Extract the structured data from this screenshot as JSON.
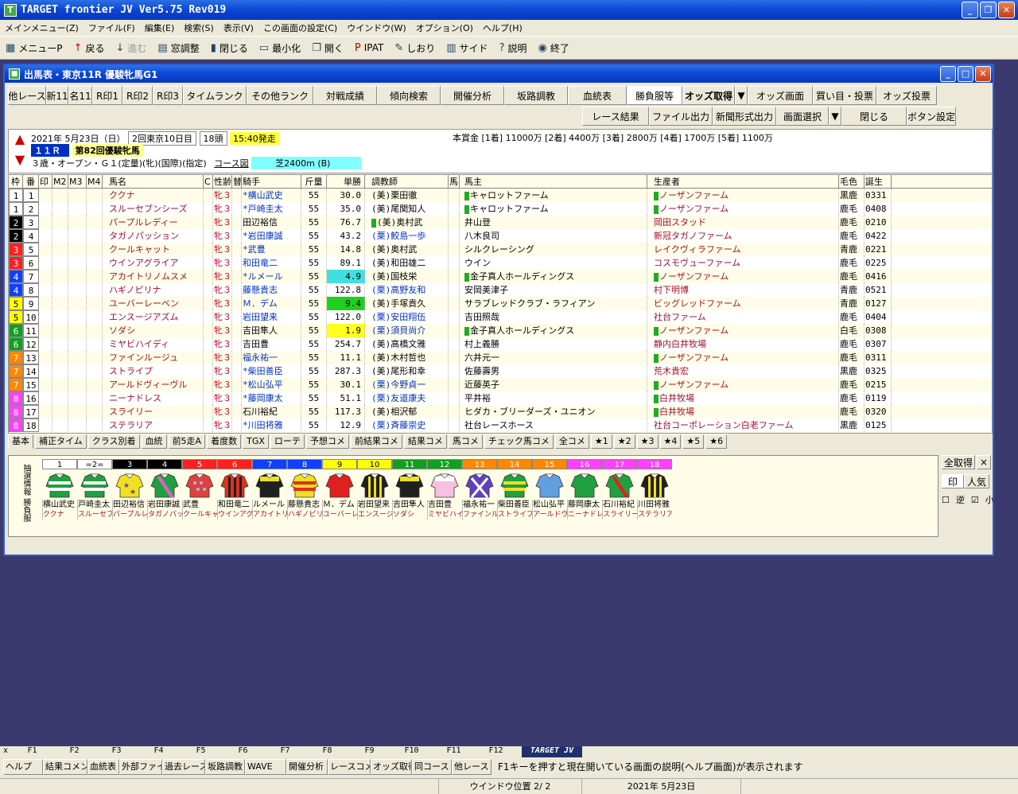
{
  "app": {
    "title": "TARGET frontier JV  Ver5.75  Rev019"
  },
  "menu": [
    "メインメニュー(Z)",
    "ファイル(F)",
    "編集(E)",
    "検索(S)",
    "表示(V)",
    "この画面の設定(C)",
    "ウインドウ(W)",
    "オプション(O)",
    "ヘルプ(H)"
  ],
  "toolbar": [
    {
      "label": "メニューP",
      "icon": "menu-icon"
    },
    {
      "label": "戻る",
      "icon": "up-arrow-icon"
    },
    {
      "label": "進む",
      "icon": "down-arrow-icon",
      "disabled": true
    },
    {
      "label": "窓調整",
      "icon": "window-icon"
    },
    {
      "label": "閉じる",
      "icon": "door-icon"
    },
    {
      "label": "最小化",
      "icon": "minimize-icon"
    },
    {
      "label": "開く",
      "icon": "open-icon"
    },
    {
      "label": "IPAT",
      "icon": "pat-icon"
    },
    {
      "label": "しおり",
      "icon": "bookmark-icon"
    },
    {
      "label": "サイド",
      "icon": "side-icon"
    },
    {
      "label": "説明",
      "icon": "help-icon"
    },
    {
      "label": "終了",
      "icon": "exit-icon"
    }
  ],
  "window": {
    "title": "出馬表・東京11R 優駿牝馬G1"
  },
  "buttons_row1": [
    {
      "label": "他レース",
      "w": 48
    },
    {
      "label": "新11",
      "w": 28
    },
    {
      "label": "名11",
      "w": 30
    },
    {
      "label": "R印1",
      "w": 38
    },
    {
      "label": "R印2",
      "w": 38
    },
    {
      "label": "R印3",
      "w": 38
    },
    {
      "label": "タイムランク",
      "w": 80
    },
    {
      "label": "その他ランク",
      "w": 84
    },
    {
      "label": "対戦成績",
      "w": 80
    },
    {
      "label": "傾向検索",
      "w": 80
    },
    {
      "label": "開催分析",
      "w": 80
    },
    {
      "label": "坂路調教",
      "w": 80
    },
    {
      "label": "血統表",
      "w": 74
    },
    {
      "label": "勝負服等",
      "w": 70,
      "sel": true
    },
    {
      "label": "オッズ取得",
      "w": 66,
      "bold": true
    },
    {
      "label": "▼",
      "w": 16
    },
    {
      "label": "オッズ画面",
      "w": 82
    },
    {
      "label": "買い目・投票",
      "w": 80
    },
    {
      "label": "オッズ投票",
      "w": 76
    }
  ],
  "buttons_row2": [
    {
      "label": "レース結果"
    },
    {
      "label": "ファイル出力"
    },
    {
      "label": "新聞形式出力"
    },
    {
      "label": "画面選択"
    },
    {
      "label": "▼"
    },
    {
      "label": "閉じる"
    },
    {
      "label": "ボタン設定"
    }
  ],
  "race": {
    "date": "2021年 5月23日（日）",
    "kai": "2回東京10日目",
    "heads": "18頭",
    "start": "15:40発走",
    "rnum": "１１Ｒ",
    "name": "第82回優駿牝馬",
    "cond": "３歳・オープン・Ｇ１(定量)(牝)(国際)(指定)",
    "course_label": "コース図",
    "course": "芝2400m (B)",
    "prize": "本賞金 [1着] 11000万 [2着] 4400万 [3着] 2800万 [4着] 1700万 [5着] 1100万"
  },
  "columns": [
    "枠",
    "番",
    "印",
    "M2",
    "M3",
    "M4",
    "馬名",
    "C",
    "性齢",
    "替",
    "騎手",
    "斤量",
    "単勝",
    "調教師",
    "馬",
    "馬主",
    "生産者",
    "毛色",
    "誕生"
  ],
  "waku_colors": {
    "1": [
      "#ffffff",
      "#000"
    ],
    "2": [
      "#000000",
      "#fff"
    ],
    "3": [
      "#ff2020",
      "#fff"
    ],
    "4": [
      "#1040ff",
      "#fff"
    ],
    "5": [
      "#ffff00",
      "#000"
    ],
    "6": [
      "#10a020",
      "#fff"
    ],
    "7": [
      "#ff8800",
      "#fff"
    ],
    "8": [
      "#ff40ff",
      "#fff"
    ]
  },
  "horses": [
    {
      "waku": "1",
      "num": "1",
      "name": "ククナ",
      "sex": "牝３",
      "jockey": "*横山武史",
      "kg": "55",
      "odds": "30.0",
      "trainer": "(美)栗田徹",
      "m": "",
      "owner": "キャロットファーム",
      "oc": true,
      "breeder": "ノーザンファーム",
      "bc": true,
      "color": "黒鹿",
      "birth": "0331"
    },
    {
      "waku": "1",
      "num": "2",
      "name": "スルーセブンシーズ",
      "sex": "牝３",
      "jockey": "*戸崎圭太",
      "kg": "55",
      "odds": "35.0",
      "trainer": "(美)尾関知人",
      "m": "",
      "owner": "キャロットファーム",
      "oc": true,
      "breeder": "ノーザンファーム",
      "bc": true,
      "color": "鹿毛",
      "birth": "0408"
    },
    {
      "waku": "2",
      "num": "3",
      "name": "パープルレディー",
      "sex": "牝３",
      "jockey": "田辺裕信",
      "kg": "55",
      "odds": "76.7",
      "trainer": "(美)奥村武",
      "m": "",
      "owner": "井山登",
      "breeder": "岡田スタッド",
      "tc": true,
      "color": "鹿毛",
      "birth": "0210"
    },
    {
      "waku": "2",
      "num": "4",
      "name": "タガノパッション",
      "sex": "牝３",
      "jockey": "*岩田康誠",
      "kg": "55",
      "odds": "43.2",
      "trainer": "(栗)鮫島一歩",
      "m": "",
      "owner": "八木良司",
      "breeder": "新冠タガノファーム",
      "color": "鹿毛",
      "birth": "0422"
    },
    {
      "waku": "3",
      "num": "5",
      "name": "クールキャット",
      "sex": "牝３",
      "jockey": "*武豊",
      "kg": "55",
      "odds": "14.8",
      "trainer": "(美)奥村武",
      "m": "",
      "owner": "シルクレーシング",
      "breeder": "レイクヴィラファーム",
      "color": "青鹿",
      "birth": "0221"
    },
    {
      "waku": "3",
      "num": "6",
      "name": "ウインアグライア",
      "sex": "牝３",
      "jockey": "和田竜二",
      "kg": "55",
      "odds": "89.1",
      "trainer": "(美)和田雄二",
      "m": "",
      "owner": "ウイン",
      "breeder": "コスモヴューファーム",
      "color": "鹿毛",
      "birth": "0225"
    },
    {
      "waku": "4",
      "num": "7",
      "name": "アカイトリノムスメ",
      "sex": "牝３",
      "jockey": "*ルメール",
      "kg": "55",
      "odds": "4.9",
      "oddbg": "#40e0e0",
      "trainer": "(美)国枝栄",
      "m": "",
      "owner": "金子真人ホールディングス",
      "oc": true,
      "breeder": "ノーザンファーム",
      "bc": true,
      "color": "鹿毛",
      "birth": "0416"
    },
    {
      "waku": "4",
      "num": "8",
      "name": "ハギノピリナ",
      "sex": "牝３",
      "jockey": "藤懸貴志",
      "kg": "55",
      "odds": "122.8",
      "trainer": "(栗)高野友和",
      "m": "",
      "owner": "安岡美津子",
      "breeder": "村下明博",
      "color": "青鹿",
      "birth": "0521"
    },
    {
      "waku": "5",
      "num": "9",
      "name": "ユーバーレーベン",
      "sex": "牝３",
      "jockey": "Ｍ．デム",
      "kg": "55",
      "odds": "9.4",
      "oddbg": "#20d020",
      "trainer": "(美)手塚貴久",
      "m": "",
      "owner": "サラブレッドクラブ・ラフィアン",
      "breeder": "ビッグレッドファーム",
      "color": "青鹿",
      "birth": "0127"
    },
    {
      "waku": "5",
      "num": "10",
      "name": "エンスージアズム",
      "sex": "牝３",
      "jockey": "岩田望来",
      "kg": "55",
      "odds": "122.0",
      "trainer": "(栗)安田翔伍",
      "m": "",
      "owner": "吉田照哉",
      "breeder": "社台ファーム",
      "color": "鹿毛",
      "birth": "0404"
    },
    {
      "waku": "6",
      "num": "11",
      "name": "ソダシ",
      "sex": "牝３",
      "jockey": "吉田隼人",
      "kg": "55",
      "odds": "1.9",
      "oddbg": "#ffff20",
      "trainer": "(栗)須貝尚介",
      "m": "",
      "owner": "金子真人ホールディングス",
      "oc": true,
      "breeder": "ノーザンファーム",
      "bc": true,
      "color": "白毛",
      "birth": "0308"
    },
    {
      "waku": "6",
      "num": "12",
      "name": "ミヤビハイディ",
      "sex": "牝３",
      "jockey": "吉田豊",
      "kg": "55",
      "odds": "254.7",
      "trainer": "(美)高橋文雅",
      "m": "",
      "owner": "村上義勝",
      "breeder": "静内白井牧場",
      "color": "鹿毛",
      "birth": "0307"
    },
    {
      "waku": "7",
      "num": "13",
      "name": "ファインルージュ",
      "sex": "牝３",
      "jockey": "福永祐一",
      "kg": "55",
      "odds": "11.1",
      "trainer": "(美)木村哲也",
      "m": "",
      "owner": "六井元一",
      "breeder": "ノーザンファーム",
      "bc": true,
      "color": "鹿毛",
      "birth": "0311"
    },
    {
      "waku": "7",
      "num": "14",
      "name": "ストライプ",
      "sex": "牝３",
      "jockey": "*柴田善臣",
      "kg": "55",
      "odds": "287.3",
      "trainer": "(美)尾形和幸",
      "m": "",
      "owner": "佐藤壽男",
      "breeder": "荒木貴宏",
      "color": "黒鹿",
      "birth": "0325"
    },
    {
      "waku": "7",
      "num": "15",
      "name": "アールドヴィーヴル",
      "sex": "牝３",
      "jockey": "*松山弘平",
      "kg": "55",
      "odds": "30.1",
      "trainer": "(栗)今野貞一",
      "m": "",
      "owner": "近藤英子",
      "breeder": "ノーザンファーム",
      "bc": true,
      "color": "鹿毛",
      "birth": "0215"
    },
    {
      "waku": "8",
      "num": "16",
      "name": "ニーナドレス",
      "sex": "牝３",
      "jockey": "*藤岡康太",
      "kg": "55",
      "odds": "51.1",
      "trainer": "(栗)友道康夫",
      "m": "",
      "owner": "平井裕",
      "breeder": "白井牧場",
      "bc": true,
      "color": "鹿毛",
      "birth": "0119"
    },
    {
      "waku": "8",
      "num": "17",
      "name": "スライリー",
      "sex": "牝３",
      "jockey": "石川裕紀",
      "kg": "55",
      "odds": "117.3",
      "trainer": "(美)相沢郁",
      "m": "",
      "owner": "ヒダカ・ブリーダーズ・ユニオン",
      "breeder": "白井牧場",
      "bc": true,
      "color": "鹿毛",
      "birth": "0320"
    },
    {
      "waku": "8",
      "num": "18",
      "name": "ステラリア",
      "sex": "牝３",
      "jockey": "*川田将雅",
      "kg": "55",
      "odds": "12.9",
      "trainer": "(栗)斉藤崇史",
      "m": "",
      "owner": "社台レースホース",
      "breeder": "社台コーポレーション白老ファーム",
      "color": "黒鹿",
      "birth": "0125"
    }
  ],
  "bottom_tabs": [
    "基本",
    "補正タイム",
    "クラス別着",
    "血統",
    "前5走A",
    "着度数",
    "TGX",
    "ローテ",
    "予想コメ",
    "前結果コメ",
    "結果コメ",
    "馬コメ",
    "チェック馬コメ",
    "全コメ",
    "★1",
    "★2",
    "★3",
    "★4",
    "★5",
    "★6"
  ],
  "silks_label": "抽選情報 勝負服",
  "silks": [
    {
      "n": "1",
      "jk": "横山武史",
      "hn": "ククナ",
      "c1": "#20a040",
      "c2": "#ffffff",
      "p": "hoop"
    },
    {
      "n": "=2=",
      "jk": "戸崎圭太",
      "hn": "スルーセブンシーズ",
      "c1": "#20a040",
      "c2": "#ffffff",
      "p": "hoop"
    },
    {
      "n": "3",
      "jk": "田辺裕信",
      "hn": "パープルレディー",
      "c1": "#f0e020",
      "c2": "#6040a0",
      "p": "star"
    },
    {
      "n": "4",
      "jk": "岩田康誠",
      "hn": "タガノパッション",
      "c1": "#20a040",
      "c2": "#e060c0",
      "p": "sash"
    },
    {
      "n": "5",
      "jk": "武豊",
      "hn": "クールキャット",
      "c1": "#e04040",
      "c2": "#a0c0e0",
      "p": "dots"
    },
    {
      "n": "6",
      "jk": "和田竜二",
      "hn": "ウインアグライア",
      "c1": "#e03020",
      "c2": "#202020",
      "p": "vstripe"
    },
    {
      "n": "7",
      "jk": "ルメール",
      "hn": "アカイトリノムスメ",
      "c1": "#202020",
      "c2": "#f0e020",
      "p": "yoke"
    },
    {
      "n": "8",
      "jk": "藤懸貴志",
      "hn": "ハギノピリナ",
      "c1": "#f0e020",
      "c2": "#e03020",
      "p": "hoop"
    },
    {
      "n": "9",
      "jk": "Ｍ．デム",
      "hn": "ユーバーレーベン",
      "c1": "#e02020",
      "c2": "#20a040",
      "p": "plain"
    },
    {
      "n": "10",
      "jk": "岩田望来",
      "hn": "エンスージアズム",
      "c1": "#202020",
      "c2": "#f0e020",
      "p": "vstripe"
    },
    {
      "n": "11",
      "jk": "吉田隼人",
      "hn": "ソダシ",
      "c1": "#202020",
      "c2": "#f0e020",
      "p": "yoke"
    },
    {
      "n": "12",
      "jk": "吉田豊",
      "hn": "ミヤビハイディ",
      "c1": "#f8c0e0",
      "c2": "#ffffff",
      "p": "yoke"
    },
    {
      "n": "13",
      "jk": "福永祐一",
      "hn": "ファインルージュ",
      "c1": "#6040c0",
      "c2": "#ffffff",
      "p": "cross"
    },
    {
      "n": "14",
      "jk": "柴田善臣",
      "hn": "ストライプ",
      "c1": "#20a040",
      "c2": "#f0e020",
      "p": "hoop"
    },
    {
      "n": "15",
      "jk": "松山弘平",
      "hn": "アールドヴィーヴル",
      "c1": "#60a0e0",
      "c2": "#ffffff",
      "p": "plain"
    },
    {
      "n": "16",
      "jk": "藤岡康太",
      "hn": "ニーナドレス",
      "c1": "#20a040",
      "c2": "#ffffff",
      "p": "plain"
    },
    {
      "n": "17",
      "jk": "石川裕紀",
      "hn": "スライリー",
      "c1": "#20a040",
      "c2": "#e02020",
      "p": "sash"
    },
    {
      "n": "18",
      "jk": "川田将雅",
      "hn": "ステラリア",
      "c1": "#202020",
      "c2": "#f0e020",
      "p": "vstripe"
    }
  ],
  "right_ctrl": {
    "all": "全取得",
    "close": "×",
    "mark": "印",
    "pop": "人気",
    "rev": "逆",
    "small": "小"
  },
  "fkeys": {
    "nums": [
      "F1",
      "F2",
      "F3",
      "F4",
      "F5",
      "F6",
      "F7",
      "F8",
      "F9",
      "F10",
      "F11",
      "F12"
    ],
    "labels": [
      "ヘルプ",
      "結果コメント",
      "血統表",
      "外部ファイル",
      "過去レース",
      "坂路調教",
      "WAVE",
      "開催分析",
      "レースコメント",
      "オッズ取得",
      "同コース",
      "他レース"
    ],
    "logo": "TARGET JV",
    "help": "F1キーを押すと現在開いている画面の説明(ヘルプ画面)が表示されます"
  },
  "status": {
    "pos": "ウインドウ位置 2/ 2",
    "date": "2021年 5月23日"
  }
}
